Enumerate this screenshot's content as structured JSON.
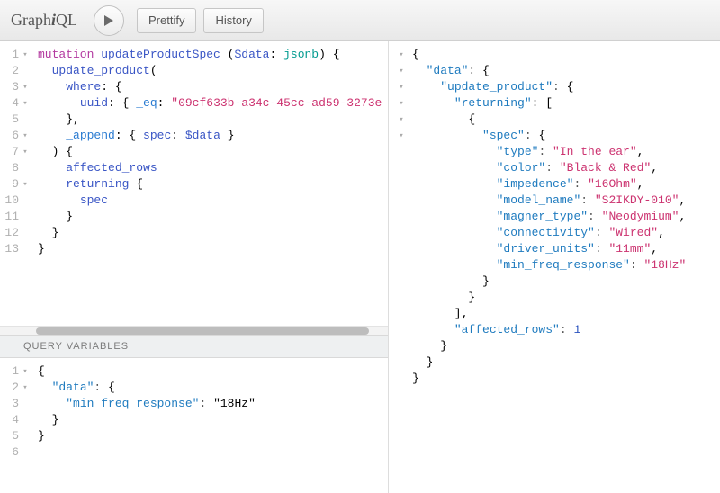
{
  "toolbar": {
    "logo_prefix": "Graph",
    "logo_i": "i",
    "logo_suffix": "QL",
    "prettify": "Prettify",
    "history": "History"
  },
  "query": {
    "lines": [
      "mutation updateProductSpec ($data: jsonb) {",
      "  update_product(",
      "    where: {",
      "      uuid: { _eq: \"09cf633b-a34c-45cc-ad59-3273e",
      "    },",
      "    _append: { spec: $data }",
      "  ) {",
      "    affected_rows",
      "    returning {",
      "      spec",
      "    }",
      "  }",
      "}"
    ]
  },
  "vars_label": "Query Variables",
  "variables": {
    "lines": [
      "{",
      "  \"data\": {",
      "    \"min_freq_response\": \"18Hz\"",
      "  }",
      "}",
      ""
    ]
  },
  "result": {
    "data": {
      "update_product": {
        "returning": [
          {
            "spec": {
              "type": "In the ear",
              "color": "Black & Red",
              "impedence": "16Ohm",
              "model_name": "S2IKDY-010",
              "magner_type": "Neodymium",
              "connectivity": "Wired",
              "driver_units": "11mm",
              "min_freq_response": "18Hz"
            }
          }
        ],
        "affected_rows": 1
      }
    }
  },
  "chart_data": null
}
